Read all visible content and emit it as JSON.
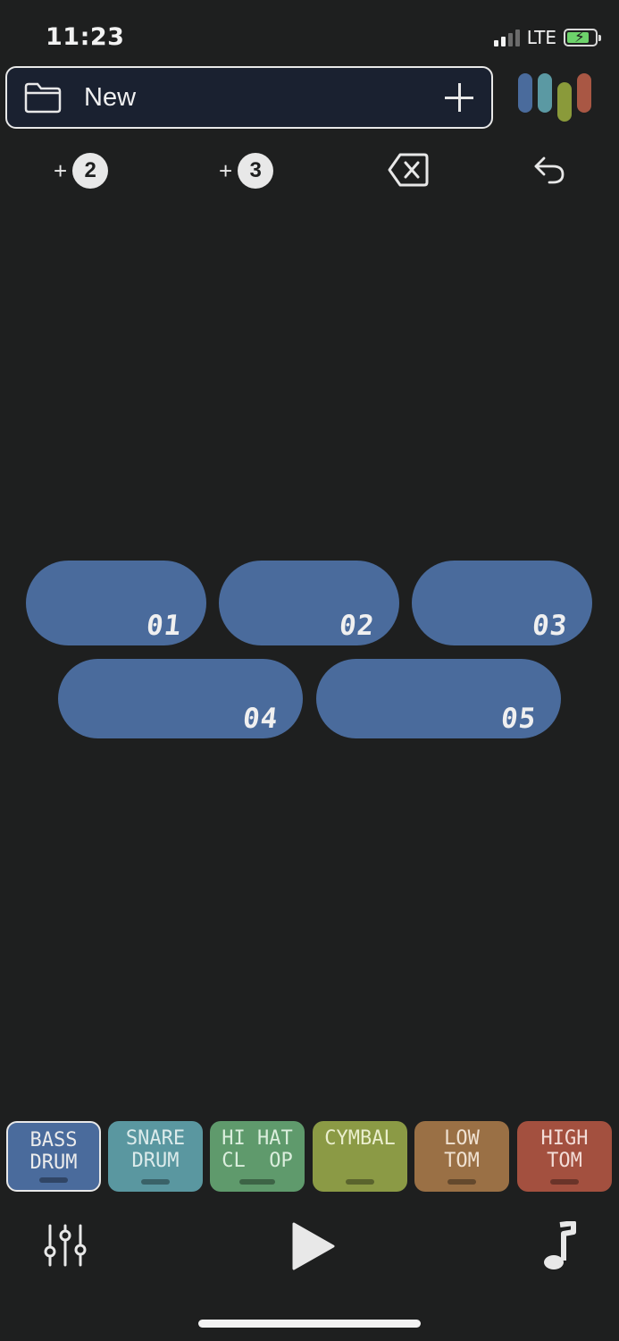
{
  "status": {
    "time": "11:23",
    "network": "LTE"
  },
  "file_bar": {
    "name": "New"
  },
  "logo_colors": [
    "#4a6b9c",
    "#5b99a3",
    "#8a9a3a",
    "#a95744"
  ],
  "toolbar": {
    "add_two_label": "2",
    "add_three_label": "3"
  },
  "pills": [
    {
      "label": "01"
    },
    {
      "label": "02"
    },
    {
      "label": "03"
    },
    {
      "label": "04"
    },
    {
      "label": "05"
    }
  ],
  "pill_color": "#4a6b9c",
  "instruments": [
    {
      "line1": "BASS",
      "line2": "DRUM",
      "color": "#4a6b9c",
      "text_color": "#ececec",
      "active": true
    },
    {
      "line1": "SNARE",
      "line2": "DRUM",
      "color": "#5a97a0",
      "text_color": "#dcebeb",
      "active": false
    },
    {
      "line1": "HI HAT",
      "line2": "CL  OP",
      "color": "#5f9a6c",
      "text_color": "#dbeedd",
      "active": false
    },
    {
      "line1": "CYMBAL",
      "line2": "",
      "color": "#8b9a45",
      "text_color": "#eaeecd",
      "active": false
    },
    {
      "line1": "LOW",
      "line2": "TOM",
      "color": "#9a7045",
      "text_color": "#f0e2d2",
      "active": false
    },
    {
      "line1": "HIGH",
      "line2": "TOM",
      "color": "#a3503f",
      "text_color": "#f3ddd8",
      "active": false
    }
  ]
}
